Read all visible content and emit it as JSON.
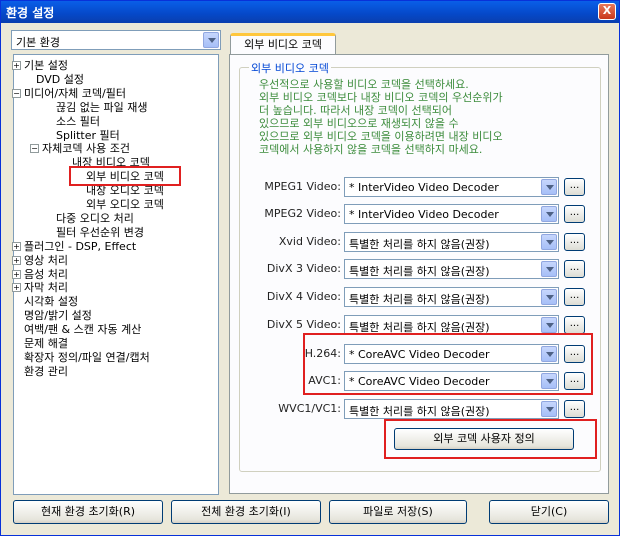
{
  "window": {
    "title": "환경 설정",
    "close_glyph": "X"
  },
  "category_combo": {
    "value": "기본 환경"
  },
  "tree": {
    "items": [
      {
        "label": "기본 설정",
        "expander": "+"
      },
      {
        "label": "DVD 설정",
        "expander": ""
      },
      {
        "label": "미디어/자체 코덱/필터",
        "expander": "−"
      },
      {
        "label": "끊김 없는 파일 재생",
        "expander": ""
      },
      {
        "label": "소스 필터",
        "expander": ""
      },
      {
        "label": "Splitter 필터",
        "expander": ""
      },
      {
        "label": "자체코덱 사용 조건",
        "expander": "−"
      },
      {
        "label": "내장 비디오 코덱",
        "expander": ""
      },
      {
        "label": "외부 비디오 코덱",
        "expander": ""
      },
      {
        "label": "내장 오디오 코덱",
        "expander": ""
      },
      {
        "label": "외부 오디오 코덱",
        "expander": ""
      },
      {
        "label": "다중 오디오 처리",
        "expander": ""
      },
      {
        "label": "필터 우선순위 변경",
        "expander": ""
      },
      {
        "label": "플러그인 - DSP, Effect",
        "expander": "+"
      },
      {
        "label": "영상 처리",
        "expander": "+"
      },
      {
        "label": "음성 처리",
        "expander": "+"
      },
      {
        "label": "자막 처리",
        "expander": "+"
      },
      {
        "label": "시각화 설정",
        "expander": ""
      },
      {
        "label": "명암/밝기 설정",
        "expander": ""
      },
      {
        "label": "여백/팬 & 스캔 자동 계산",
        "expander": ""
      },
      {
        "label": "문제 해결",
        "expander": ""
      },
      {
        "label": "확장자 정의/파일 연결/캡처",
        "expander": ""
      },
      {
        "label": "환경 관리",
        "expander": ""
      }
    ]
  },
  "tab": {
    "label": "외부 비디오 코덱"
  },
  "group": {
    "label": "외부 비디오 코덱",
    "description": "우선적으로 사용할 비디오 코덱을 선택하세요.\n외부 비디오 코덱보다 내장 비디오 코덱의 우선순위가\n더 높습니다. 따라서 내장 코덱이 선택되어\n있으므로 외부 비디오으로 재생되지 않을 수\n있으므로 외부 비디오 코덱을 이용하려면 내장 비디오\n코덱에서 사용하지 않을 코덱을 선택하지 마세요."
  },
  "codecs": [
    {
      "label": "MPEG1 Video:",
      "value": "* InterVideo Video Decoder",
      "button": "..."
    },
    {
      "label": "MPEG2 Video:",
      "value": "* InterVideo Video Decoder",
      "button": "..."
    },
    {
      "label": "Xvid Video:",
      "value": "특별한 처리를 하지 않음(권장)",
      "button": "..."
    },
    {
      "label": "DivX 3 Video:",
      "value": "특별한 처리를 하지 않음(권장)",
      "button": "..."
    },
    {
      "label": "DivX 4 Video:",
      "value": "특별한 처리를 하지 않음(권장)",
      "button": "..."
    },
    {
      "label": "DivX 5 Video:",
      "value": "특별한 처리를 하지 않음(권장)",
      "button": "..."
    },
    {
      "label": "H.264:",
      "value": "* CoreAVC Video Decoder",
      "button": "..."
    },
    {
      "label": "AVC1:",
      "value": "* CoreAVC Video Decoder",
      "button": "..."
    },
    {
      "label": "WVC1/VC1:",
      "value": "특별한 처리를 하지 않음(권장)",
      "button": "..."
    }
  ],
  "custom_button": {
    "label": "외부 코덱 사용자 정의"
  },
  "footer": {
    "reset_current": "현재 환경 초기화(R)",
    "reset_all": "전체 환경 초기화(I)",
    "save_file": "파일로 저장(S)",
    "close": "닫기(C)"
  },
  "colors": {
    "highlight_box": "#e02020",
    "group_label": "#0046d5",
    "description_text": "#3c8c3c"
  }
}
